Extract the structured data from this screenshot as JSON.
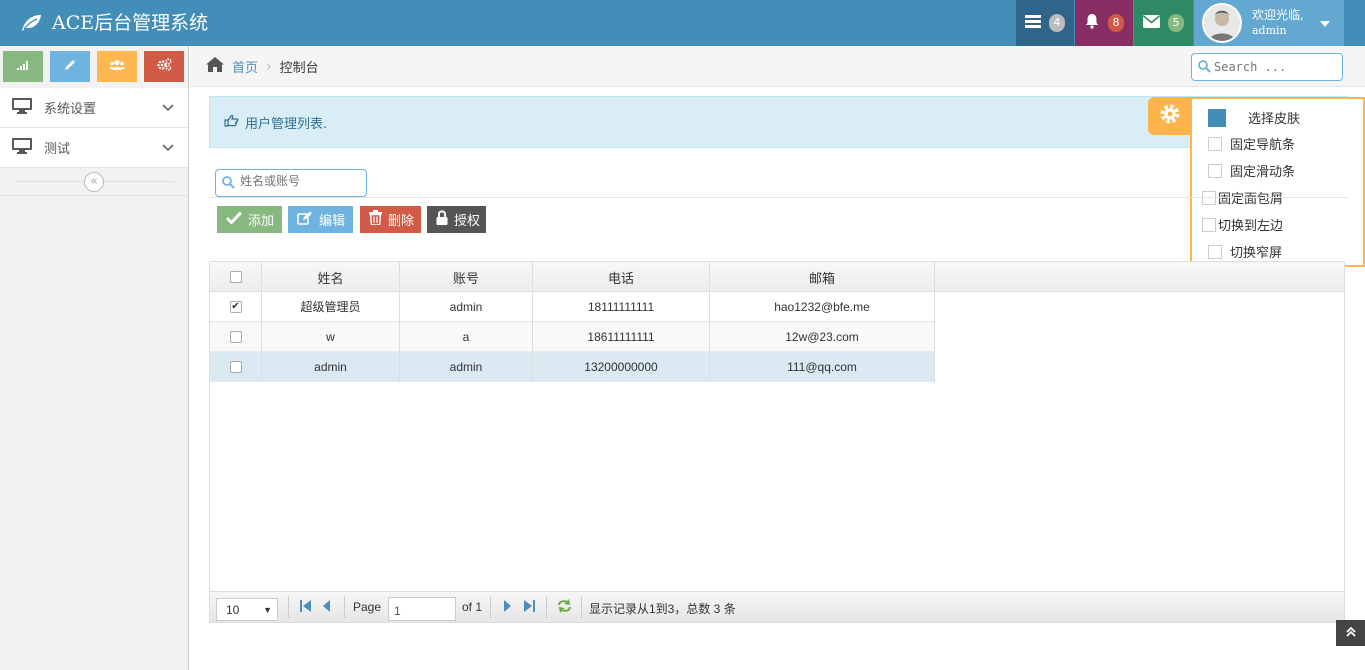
{
  "app": {
    "title": "ACE后台管理系统"
  },
  "topnav": {
    "tasks_count": "4",
    "notifications_count": "8",
    "messages_count": "5",
    "user": {
      "welcome": "欢迎光临,",
      "name": "admin"
    }
  },
  "sidebar": {
    "shortcuts": [
      "signal-icon",
      "pencil-icon",
      "users-icon",
      "cogs-icon"
    ],
    "items": [
      {
        "label": "系统设置",
        "icon": "desktop-icon"
      },
      {
        "label": "测试",
        "icon": "desktop-icon"
      }
    ]
  },
  "breadcrumb": {
    "home": "首页",
    "current": "控制台"
  },
  "search": {
    "placeholder": "Search ..."
  },
  "alert": {
    "text": "用户管理列表."
  },
  "settings": {
    "skin_label": "选择皮肤",
    "skin_color": "#438eb9",
    "options": [
      "固定导航条",
      "固定滑动条",
      "固定面包屑",
      "切换到左边",
      "切换窄屏"
    ]
  },
  "filter": {
    "placeholder": "姓名或账号"
  },
  "toolbar": {
    "add": "添加",
    "edit": "编辑",
    "delete": "删除",
    "grant": "授权"
  },
  "table": {
    "headers": [
      "姓名",
      "账号",
      "电话",
      "邮箱"
    ],
    "rows": [
      {
        "checked": true,
        "name": "超级管理员",
        "account": "admin",
        "phone": "18111111111",
        "email": "hao1232@bfe.me"
      },
      {
        "checked": false,
        "name": "w",
        "account": "a",
        "phone": "18611111111",
        "email": "12w@23.com"
      },
      {
        "checked": false,
        "name": "admin",
        "account": "admin",
        "phone": "13200000000",
        "email": "111@qq.com"
      }
    ]
  },
  "pager": {
    "page_size": "10",
    "page_label": "Page",
    "page_value": "1",
    "of_label": "of 1",
    "summary": "显示记录从1到3，总数 3 条"
  },
  "colors": {
    "navbar": "#438eb9",
    "tasks": "#2e6589",
    "bell": "#892e65",
    "mail": "#2e8965",
    "user": "#62a8d1",
    "accent_orange": "#ffb44b"
  }
}
